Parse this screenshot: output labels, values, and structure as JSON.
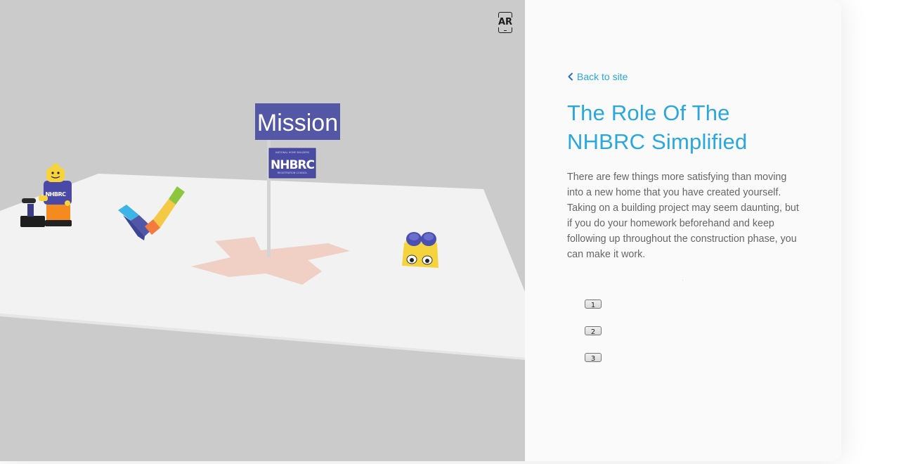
{
  "ar_button": {
    "label": "AR",
    "icon": "ar-phone-icon"
  },
  "scene": {
    "mission_sign": "Mission",
    "logo_sign": {
      "text": "NHBRC",
      "small_text_top": "NATIONAL HOME BUILDERS",
      "small_text_bottom": "REGISTRATION COUNCIL"
    },
    "figure_shirt_text": "NHBRC",
    "colors": {
      "background": "#cbcbcb",
      "floor": "#f2f2f2",
      "sign": "#5457a6",
      "cross": "#f0c9bd"
    }
  },
  "panel": {
    "back_link": "Back to site",
    "title_line1": "The Role Of The",
    "title_line2": "NHBRC Simplified",
    "body": "There are few things more satisfying than moving into a new home that you have created yourself. Taking on a building project may seem daunting, but if you do your homework beforehand and keep following up throughout the construction phase, you can make it work.",
    "steps": [
      "1",
      "2",
      "3"
    ],
    "accent_color": "#2aa7dd"
  }
}
